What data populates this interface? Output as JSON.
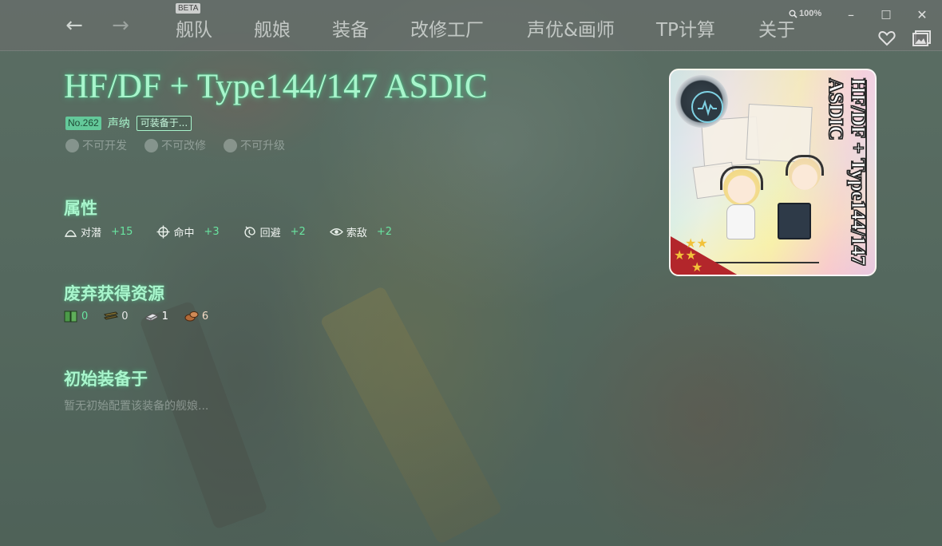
{
  "nav": {
    "back_glyph": "←",
    "forward_glyph": "→",
    "beta_label": "BETA",
    "items": [
      "舰队",
      "舰娘",
      "装备",
      "改修工厂",
      "声优&画师",
      "TP计算",
      "关于"
    ],
    "zoom": "100%"
  },
  "window": {
    "minimize": "–",
    "maximize": "□",
    "close": "✕"
  },
  "equipment": {
    "name": "HF/DF + Type144/147 ASDIC",
    "number": "No.262",
    "type": "声纳",
    "equip_button": "可装备于...",
    "flags": [
      "不可开发",
      "不可改修",
      "不可升级"
    ]
  },
  "stats_section": {
    "title": "属性",
    "items": [
      {
        "label": "对潜",
        "value": "+15",
        "icon": "anti-sub-icon"
      },
      {
        "label": "命中",
        "value": "+3",
        "icon": "accuracy-icon"
      },
      {
        "label": "回避",
        "value": "+2",
        "icon": "evasion-icon"
      },
      {
        "label": "索敌",
        "value": "+2",
        "icon": "los-icon"
      }
    ]
  },
  "scrap_section": {
    "title": "废弃获得资源",
    "items": [
      {
        "name": "fuel",
        "value": "0",
        "color": "#5fae5a"
      },
      {
        "name": "ammo",
        "value": "0",
        "color": "#8b7a3a"
      },
      {
        "name": "steel",
        "value": "1",
        "color": "#c9ccd0"
      },
      {
        "name": "bauxite",
        "value": "6",
        "color": "#c07a48"
      }
    ]
  },
  "initial_section": {
    "title": "初始装备于",
    "empty_text": "暂无初始配置该装备的舰娘..."
  },
  "card": {
    "name": "HF/DF + Type144/147 ASDIC"
  },
  "colors": {
    "accent": "#a8f5cc",
    "stat_value": "#69e4a0",
    "badge_bg": "#63c99a"
  }
}
